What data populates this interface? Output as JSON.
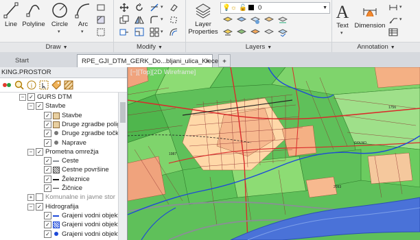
{
  "ribbon": {
    "draw": {
      "title": "Draw",
      "tools": [
        {
          "label": "Line",
          "icon": "line-icon"
        },
        {
          "label": "Polyline",
          "icon": "polyline-icon"
        },
        {
          "label": "Circle",
          "icon": "circle-icon"
        },
        {
          "label": "Arc",
          "icon": "arc-icon"
        }
      ]
    },
    "modify": {
      "title": "Modify"
    },
    "layers": {
      "title": "Layers",
      "properties_label": "Layer Properties",
      "current_layer": "0"
    },
    "annotation": {
      "title": "Annotation",
      "text_label": "Text",
      "dimension_label": "Dimension"
    }
  },
  "tabs": {
    "start": "Start",
    "drawing": "RPE_GJI_DTM_GERK_Do...bljani_ulica_Klece*",
    "close": "×",
    "add": "+"
  },
  "leftpanel": {
    "title": "KING.PROSTOR",
    "tree": [
      {
        "label": "GURS DTM",
        "level": 0
      },
      {
        "label": "Stavbe",
        "level": 1
      },
      {
        "label": "Stavbe",
        "level": 2
      },
      {
        "label": "Druge zgradbe polig",
        "level": 2
      },
      {
        "label": "Druge zgradbe točke",
        "level": 2
      },
      {
        "label": "Naprave",
        "level": 2
      },
      {
        "label": "Prometna omrežja",
        "level": 1
      },
      {
        "label": "Ceste",
        "level": 2
      },
      {
        "label": "Cestne površine",
        "level": 2
      },
      {
        "label": "Železnice",
        "level": 2
      },
      {
        "label": "Žičnice",
        "level": 2
      },
      {
        "label": "Komunalne in javne stor",
        "level": 1
      },
      {
        "label": "Hidrografija",
        "level": 1
      },
      {
        "label": "Grajeni vodni objekti",
        "level": 2
      },
      {
        "label": "Grajeni vodni objekti",
        "level": 2
      },
      {
        "label": "Grajeni vodni objekti",
        "level": 2
      }
    ]
  },
  "map": {
    "view_label": "[−][Top][2D Wireframe]"
  }
}
